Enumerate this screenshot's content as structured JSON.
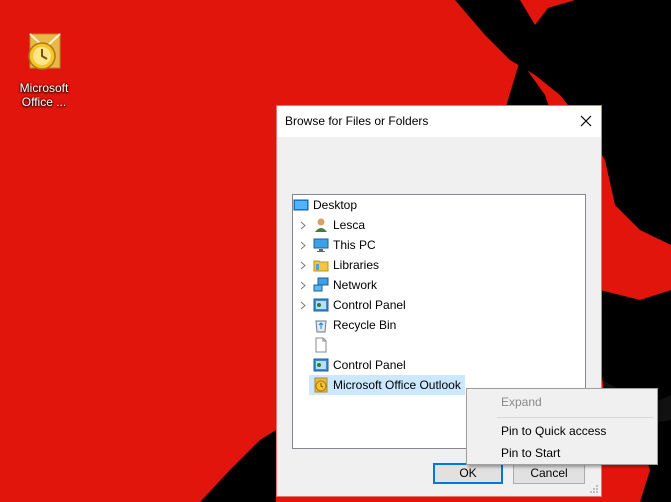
{
  "desktop": {
    "icon_label": "Microsoft Office ..."
  },
  "dialog": {
    "title": "Browse for Files or Folders",
    "tree": {
      "root": "Desktop",
      "items": [
        {
          "label": "Lesca",
          "expandable": true,
          "icon": "user-icon"
        },
        {
          "label": "This PC",
          "expandable": true,
          "icon": "computer-icon"
        },
        {
          "label": "Libraries",
          "expandable": true,
          "icon": "libraries-icon"
        },
        {
          "label": "Network",
          "expandable": true,
          "icon": "network-icon"
        },
        {
          "label": "Control Panel",
          "expandable": true,
          "icon": "control-panel-icon"
        },
        {
          "label": "Recycle Bin",
          "expandable": false,
          "icon": "recycle-bin-icon"
        },
        {
          "label": "",
          "expandable": false,
          "icon": "blank-file-icon"
        },
        {
          "label": "Control Panel",
          "expandable": false,
          "icon": "control-panel-icon"
        },
        {
          "label": "Microsoft Office Outlook",
          "expandable": false,
          "icon": "outlook-icon",
          "selected": true
        }
      ]
    },
    "ok_label": "OK",
    "cancel_label": "Cancel"
  },
  "context_menu": {
    "items": [
      {
        "label": "Expand",
        "disabled": true
      },
      {
        "label": "Pin to Quick access",
        "disabled": false
      },
      {
        "label": "Pin to Start",
        "disabled": false
      }
    ]
  },
  "colors": {
    "wallpaper_red": "#e2150c",
    "silhouette": "#000000",
    "selection": "#cce8ff",
    "accent": "#0078d7"
  }
}
